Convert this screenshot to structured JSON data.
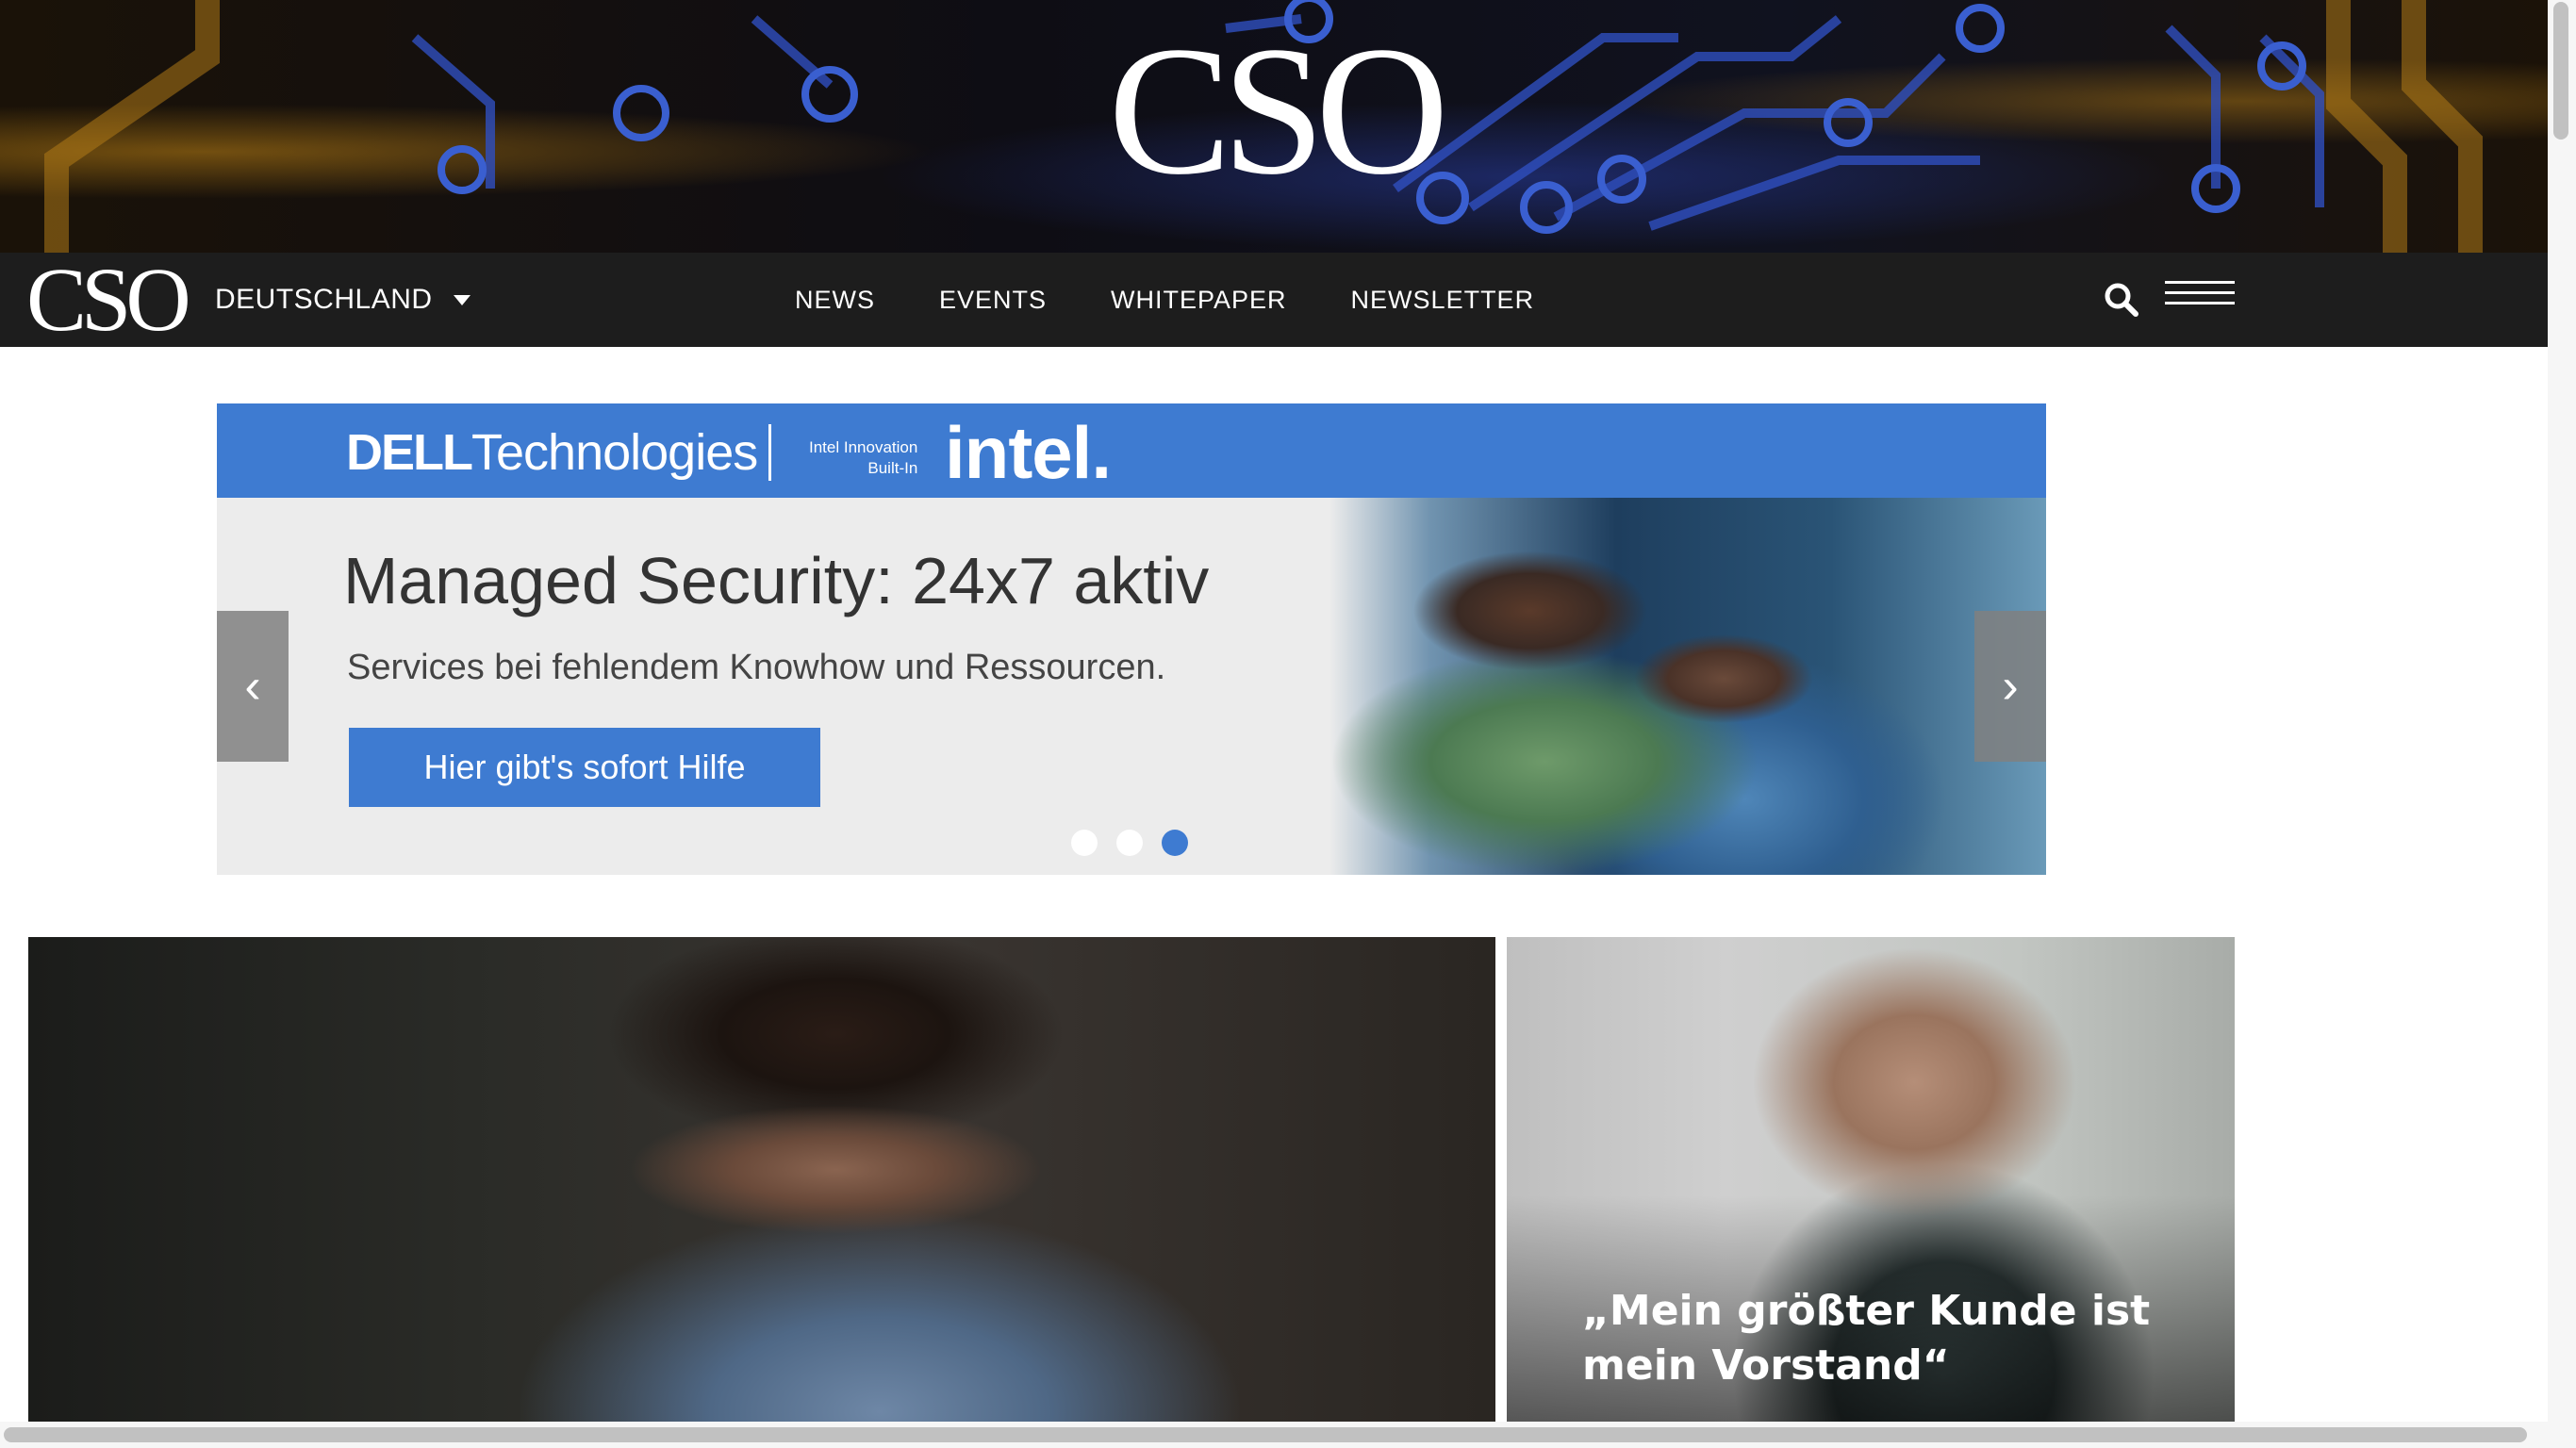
{
  "hero": {
    "logo_text": "CSO"
  },
  "nav": {
    "logo_text": "CSO",
    "edition": "DEUTSCHLAND",
    "menu": [
      "NEWS",
      "EVENTS",
      "WHITEPAPER",
      "NEWSLETTER"
    ]
  },
  "ad": {
    "brand_prefix": "D",
    "brand_e": "E",
    "brand_ll": "LL",
    "brand_rest": "Technologies",
    "intel_line1": "Intel Innovation",
    "intel_line2": "Built-In",
    "intel_logo": "intel.",
    "headline": "Managed Security: 24x7 aktiv",
    "subline": "Services bei fehlendem Knowhow und Ressourcen.",
    "cta": "Hier gibt's sofort Hilfe",
    "prev_glyph": "‹",
    "next_glyph": "›",
    "slide_count": 3,
    "active_slide": 3
  },
  "features": [
    {
      "title": ""
    },
    {
      "title": "„Mein größter Kunde ist mein Vorstand“"
    }
  ],
  "colors": {
    "brand_blue": "#3e7bd1",
    "nav_bg": "#1d1d1d"
  }
}
